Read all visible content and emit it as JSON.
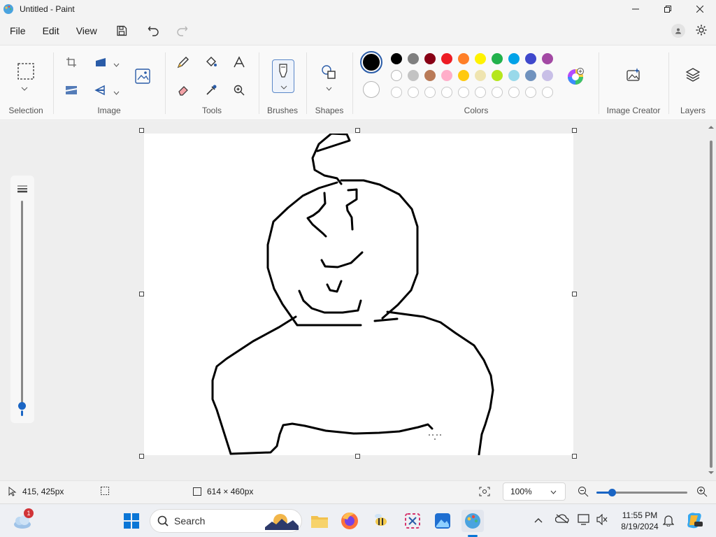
{
  "window": {
    "title": "Untitled - Paint"
  },
  "menu": {
    "file": "File",
    "edit": "Edit",
    "view": "View"
  },
  "ribbon": {
    "selection_label": "Selection",
    "image_label": "Image",
    "tools_label": "Tools",
    "brushes_label": "Brushes",
    "shapes_label": "Shapes",
    "colors_label": "Colors",
    "image_creator_label": "Image Creator",
    "layers_label": "Layers"
  },
  "colors": {
    "primary": "#000000",
    "secondary": "#ffffff",
    "row1": [
      "#000000",
      "#7f7f7f",
      "#880015",
      "#ed1c24",
      "#ff7f27",
      "#fff200",
      "#22b14c",
      "#00a2e8",
      "#3f48cc",
      "#a349a4"
    ],
    "row2": [
      "#ffffff",
      "#c3c3c3",
      "#b97a57",
      "#ffaec9",
      "#ffc90e",
      "#efe4b0",
      "#b5e61d",
      "#99d9ea",
      "#7092be",
      "#c8bfe7"
    ],
    "row3": [
      "",
      "",
      "",
      "",
      "",
      "",
      "",
      "",
      "",
      ""
    ]
  },
  "status": {
    "cursor_position": "415, 425px",
    "canvas_size": "614 × 460px",
    "zoom": "100%"
  },
  "taskbar": {
    "weather_badge": "1",
    "search_placeholder": "Search",
    "time": "11:55 PM",
    "date": "8/19/2024"
  }
}
